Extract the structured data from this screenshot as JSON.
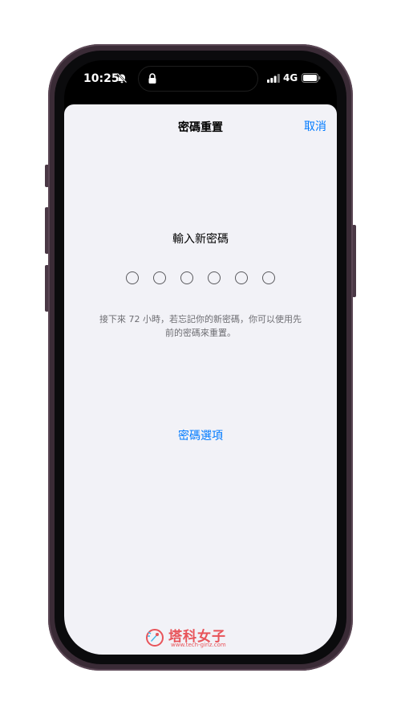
{
  "status_bar": {
    "time": "10:25",
    "network": "4G",
    "icons": [
      "bell-slash-icon",
      "lock-icon",
      "signal-icon",
      "battery-icon"
    ]
  },
  "sheet": {
    "title": "密碼重置",
    "cancel_label": "取消",
    "prompt": "輸入新密碼",
    "passcode_length": 6,
    "passcode_entered": 0,
    "hint": "接下來 72 小時，若忘記你的新密碼，你可以使用先前的密碼來重置。",
    "options_label": "密碼選項"
  },
  "watermark": {
    "name": "塔科女子",
    "url": "www.tech-girlz.com"
  },
  "colors": {
    "accent": "#007aff",
    "sheet_bg": "#f2f2f7",
    "watermark": "#e8545a",
    "frame": "#3a2b36"
  }
}
